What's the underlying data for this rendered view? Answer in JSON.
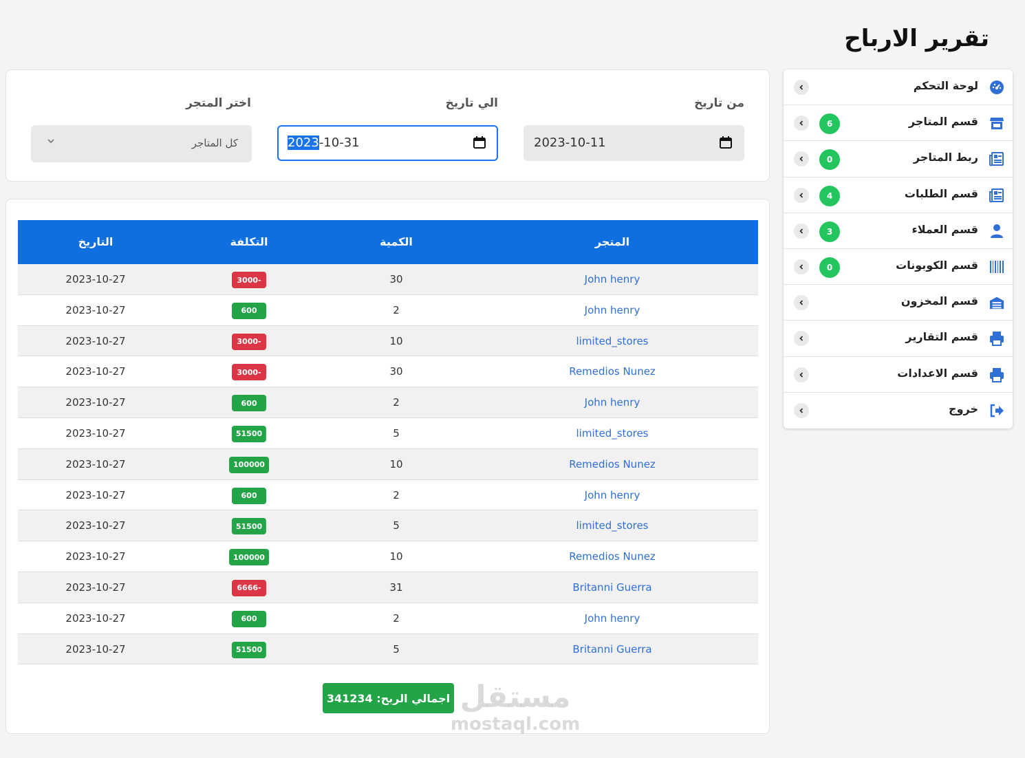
{
  "page_title": "تقرير الارباح",
  "sidebar": {
    "items": [
      {
        "label": "لوحة التحكم",
        "icon": "dashboard-icon",
        "badge": ""
      },
      {
        "label": "قسم المتاجر",
        "icon": "store-icon",
        "badge": "6"
      },
      {
        "label": "ربط المتاجر",
        "icon": "newspaper-icon",
        "badge": "0"
      },
      {
        "label": "قسم الطلبات",
        "icon": "newspaper-icon",
        "badge": "4"
      },
      {
        "label": "قسم العملاء",
        "icon": "user-icon",
        "badge": "3"
      },
      {
        "label": "قسم الكوبونات",
        "icon": "barcode-icon",
        "badge": "0"
      },
      {
        "label": "قسم المخزون",
        "icon": "warehouse-icon",
        "badge": ""
      },
      {
        "label": "قسم التقارير",
        "icon": "printer-icon",
        "badge": ""
      },
      {
        "label": "قسم الاعدادات",
        "icon": "printer-icon",
        "badge": ""
      },
      {
        "label": "خروج",
        "icon": "logout-icon",
        "badge": ""
      }
    ]
  },
  "filters": {
    "from_label": "من تاريخ",
    "from_value": "2023-10-11",
    "to_label": "الي تاريخ",
    "to_value_selected": "2023",
    "to_value_rest": "-10-31",
    "store_label": "اختر المتجر",
    "store_value": "كل المتاجر"
  },
  "table": {
    "headers": {
      "store": "المتجر",
      "qty": "الكمية",
      "cost": "التكلفة",
      "date": "التاريخ"
    },
    "rows": [
      {
        "store": "John henry",
        "qty": "30",
        "cost": "3000-",
        "date": "2023-10-27"
      },
      {
        "store": "John henry",
        "qty": "2",
        "cost": "600",
        "date": "2023-10-27"
      },
      {
        "store": "limited_stores",
        "qty": "10",
        "cost": "3000-",
        "date": "2023-10-27"
      },
      {
        "store": "Remedios Nunez",
        "qty": "30",
        "cost": "3000-",
        "date": "2023-10-27"
      },
      {
        "store": "John henry",
        "qty": "2",
        "cost": "600",
        "date": "2023-10-27"
      },
      {
        "store": "limited_stores",
        "qty": "5",
        "cost": "51500",
        "date": "2023-10-27"
      },
      {
        "store": "Remedios Nunez",
        "qty": "10",
        "cost": "100000",
        "date": "2023-10-27"
      },
      {
        "store": "John henry",
        "qty": "2",
        "cost": "600",
        "date": "2023-10-27"
      },
      {
        "store": "limited_stores",
        "qty": "5",
        "cost": "51500",
        "date": "2023-10-27"
      },
      {
        "store": "Remedios Nunez",
        "qty": "10",
        "cost": "100000",
        "date": "2023-10-27"
      },
      {
        "store": "Britanni Guerra",
        "qty": "31",
        "cost": "6666-",
        "date": "2023-10-27"
      },
      {
        "store": "John henry",
        "qty": "2",
        "cost": "600",
        "date": "2023-10-27"
      },
      {
        "store": "Britanni Guerra",
        "qty": "5",
        "cost": "51500",
        "date": "2023-10-27"
      }
    ]
  },
  "total": {
    "text": "اجمالي الربح: 341234"
  },
  "watermark": {
    "ar": "مستقل",
    "en": "mostaql.com"
  },
  "colors": {
    "accent": "#0f6fe0",
    "positive": "#22a447",
    "negative": "#dc3545",
    "badge": "#22c55e",
    "icon": "#2f6fd6"
  }
}
